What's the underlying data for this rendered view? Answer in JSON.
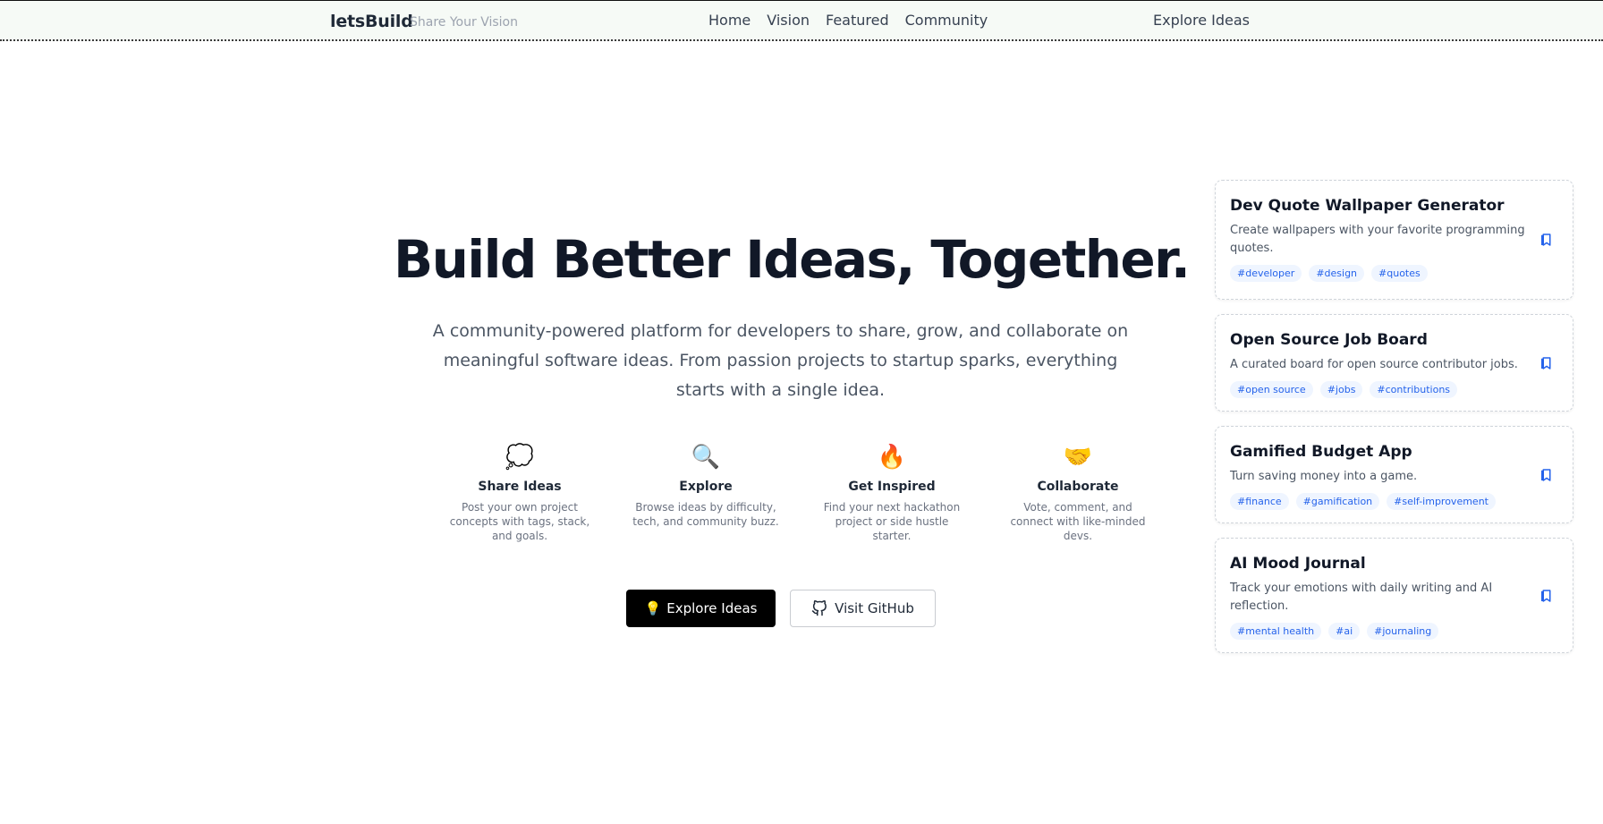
{
  "header": {
    "brand": "letsBuild",
    "tagline": "Share Your Vision",
    "nav": [
      "Home",
      "Vision",
      "Featured",
      "Community"
    ],
    "cta": "Explore Ideas"
  },
  "hero": {
    "title": "Build Better Ideas, Together. 💡",
    "description": "A community-powered platform for developers to share, grow, and collaborate on meaningful software ideas. From passion projects to startup sparks, everything starts with a single idea.",
    "features": [
      {
        "icon": "💭",
        "icon_name": "thought-bubble-icon",
        "title": "Share Ideas",
        "desc": "Post your own project concepts with tags, stack, and goals."
      },
      {
        "icon": "🔍",
        "icon_name": "magnifier-icon",
        "title": "Explore",
        "desc": "Browse ideas by difficulty, tech, and community buzz."
      },
      {
        "icon": "🔥",
        "icon_name": "fire-icon",
        "title": "Get Inspired",
        "desc": "Find your next hackathon project or side hustle starter."
      },
      {
        "icon": "🤝",
        "icon_name": "handshake-icon",
        "title": "Collaborate",
        "desc": "Vote, comment, and connect with like-minded devs."
      }
    ],
    "primary_button": {
      "icon": "💡",
      "label": "Explore Ideas"
    },
    "secondary_button": {
      "icon_name": "github-icon",
      "label": "Visit GitHub"
    }
  },
  "ideas": [
    {
      "title": "Dev Quote Wallpaper Generator",
      "desc": "Create wallpapers with your favorite programming quotes.",
      "tags": [
        "#developer",
        "#design",
        "#quotes"
      ]
    },
    {
      "title": "Open Source Job Board",
      "desc": "A curated board for open source contributor jobs.",
      "tags": [
        "#open source",
        "#jobs",
        "#contributions"
      ]
    },
    {
      "title": "Gamified Budget App",
      "desc": "Turn saving money into a game.",
      "tags": [
        "#finance",
        "#gamification",
        "#self-improvement"
      ]
    },
    {
      "title": "AI Mood Journal",
      "desc": "Track your emotions with daily writing and AI reflection.",
      "tags": [
        "#mental health",
        "#ai",
        "#journaling"
      ]
    }
  ],
  "colors": {
    "header_bg": "#f6faf6",
    "primary_button": "#000000",
    "tag_text": "#2563eb",
    "tag_bg": "#eff5ff"
  }
}
